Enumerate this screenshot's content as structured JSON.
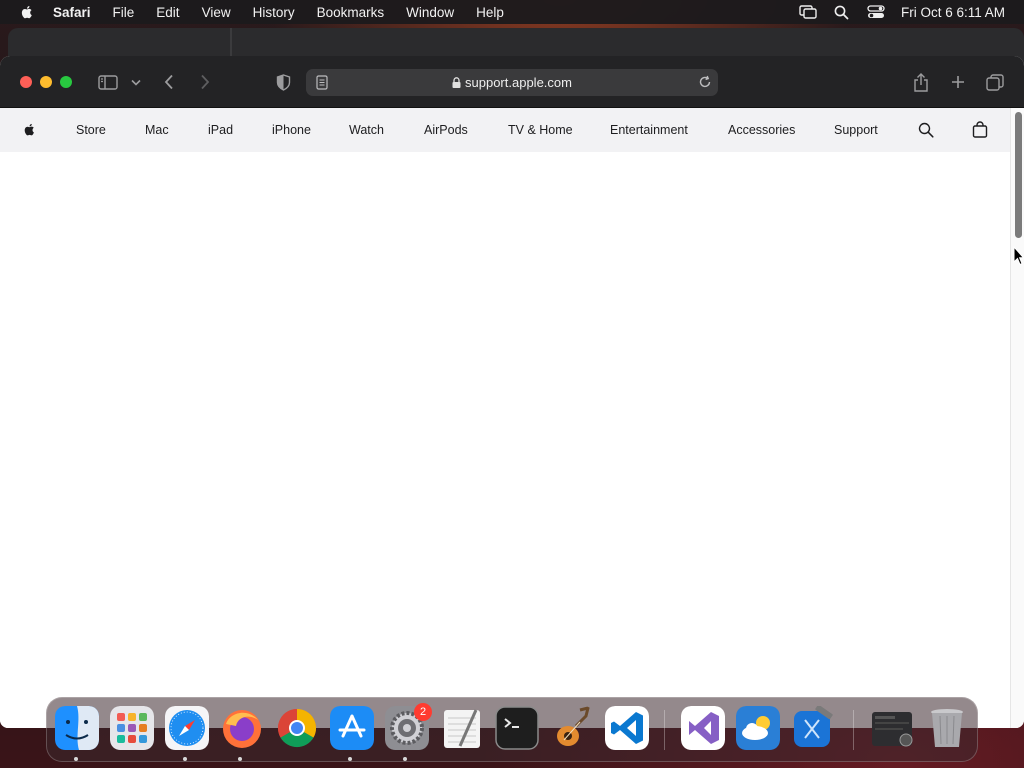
{
  "menubar": {
    "app_name": "Safari",
    "items": [
      "File",
      "Edit",
      "View",
      "History",
      "Bookmarks",
      "Window",
      "Help"
    ],
    "clock": "Fri Oct 6  6:11 AM"
  },
  "browser": {
    "url": "support.apple.com"
  },
  "apple_nav": {
    "items": [
      "Store",
      "Mac",
      "iPad",
      "iPhone",
      "Watch",
      "AirPods",
      "TV & Home",
      "Entertainment",
      "Accessories",
      "Support"
    ]
  },
  "dock": {
    "apps": [
      "Finder",
      "Launchpad",
      "Safari",
      "Firefox",
      "Google Chrome",
      "App Store",
      "System Settings",
      "TextEdit",
      "Terminal",
      "GarageBand",
      "Visual Studio Code",
      "Visual Studio",
      "Weather",
      "Xcode",
      "Downloads",
      "Trash"
    ],
    "system_settings_badge": "2"
  },
  "colors": {
    "traffic_red": "#fe5f57",
    "traffic_yellow": "#febc2e",
    "traffic_green": "#28c840",
    "toolbar": "#232325",
    "apple_nav_bg": "#f2f2f4"
  }
}
